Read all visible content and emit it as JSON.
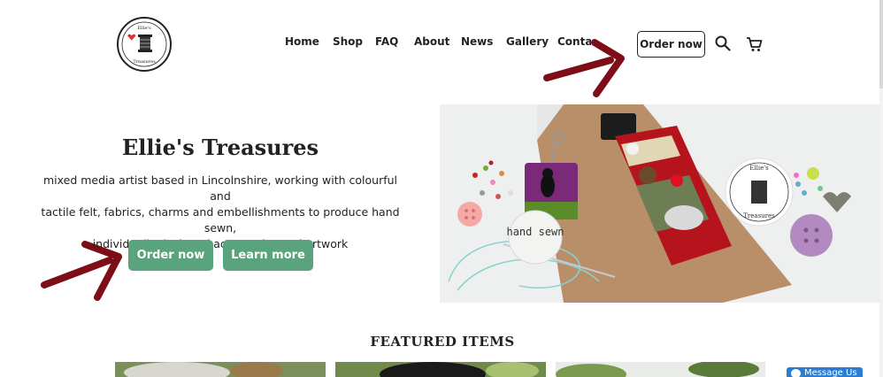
{
  "brand": {
    "logo_alt": "Ellie's Treasures logo"
  },
  "nav": {
    "items": [
      {
        "label": "Home"
      },
      {
        "label": "Shop"
      },
      {
        "label": "FAQ"
      },
      {
        "label": "About"
      },
      {
        "label": "News"
      },
      {
        "label": "Gallery"
      },
      {
        "label": "Contact"
      }
    ],
    "order_label": "Order now",
    "icons": [
      "search-icon",
      "cart-icon"
    ]
  },
  "hero": {
    "title": "Ellie's Treasures",
    "description_lines": [
      "mixed media artist based in Lincolnshire, working with colourful and",
      "tactile felt, fabrics, charms and embellishments to produce hand sewn,",
      "individually designed accessories and artwork"
    ],
    "order_label": "Order now",
    "learn_label": "Learn more",
    "image_tag": "hand sewn"
  },
  "featured": {
    "heading": "FEATURED ITEMS"
  },
  "messenger": {
    "label": "Message Us"
  },
  "colors": {
    "accent": "#5aa37f",
    "arrow": "#7d0e17",
    "messenger": "#2b7cd3"
  }
}
